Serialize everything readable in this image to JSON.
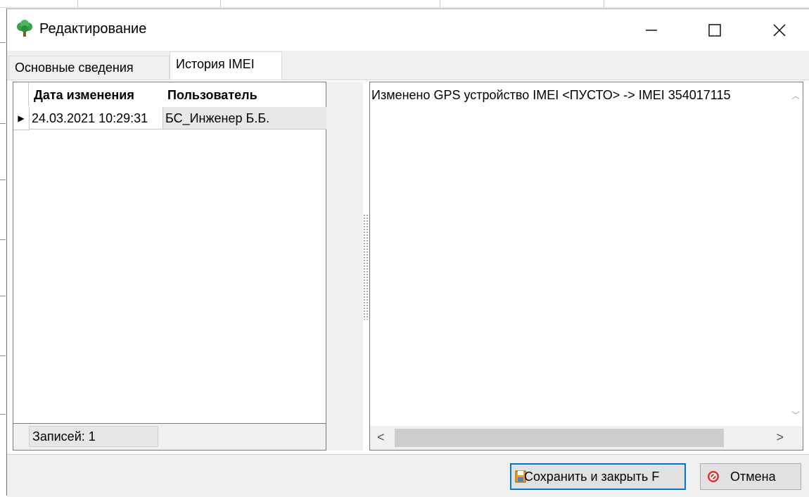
{
  "window": {
    "title": "Редактирование"
  },
  "tabs": [
    {
      "label": "Основные сведения",
      "active": false
    },
    {
      "label": "История IMEI",
      "active": true
    }
  ],
  "grid": {
    "columns": [
      "Дата изменения",
      "Пользователь"
    ],
    "rows": [
      {
        "date": "24.03.2021 10:29:31",
        "user": "БС_Инженер Б.Б."
      }
    ],
    "row_indicator": "▶",
    "records_label": "Записей: 1"
  },
  "details": {
    "text": "Изменено GPS устройство IMEI <ПУСТО> -> IMEI 354017115"
  },
  "buttons": {
    "save": "Сохранить и закрыть F",
    "cancel": "Отмена"
  },
  "colors": {
    "focus_border": "#0078d7",
    "cancel_icon": "#e0302a",
    "app_icon_green": "#3aa04a"
  },
  "icons": {
    "app": "tree-icon",
    "minimize": "minimize-icon",
    "maximize": "maximize-icon",
    "close": "close-icon",
    "save": "save-icon",
    "cancel": "cancel-icon"
  }
}
